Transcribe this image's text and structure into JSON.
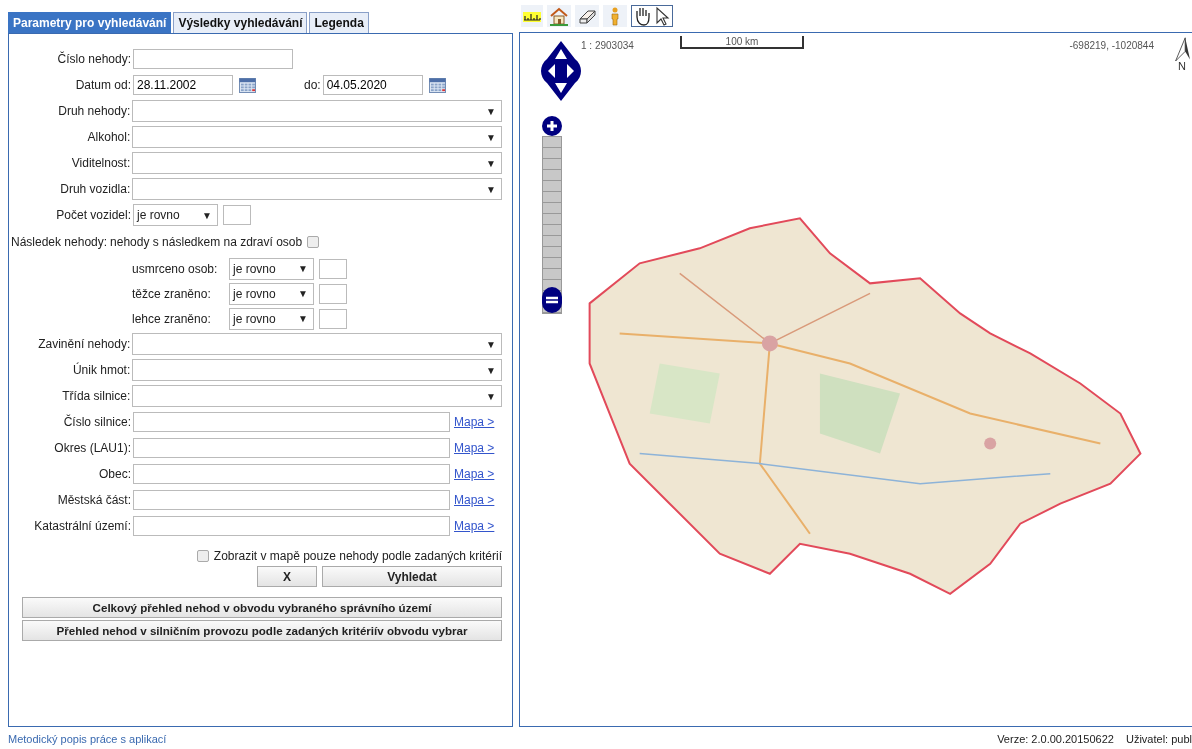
{
  "tabs": [
    {
      "label": "Parametry pro vyhledávání",
      "selected": true
    },
    {
      "label": "Výsledky vyhledávání",
      "selected": false
    },
    {
      "label": "Legenda",
      "selected": false
    }
  ],
  "form": [
    {
      "kind": "text",
      "label": "Číslo nehody:"
    },
    {
      "kind": "date",
      "label": "Datum od:",
      "value": "28.11.2002",
      "to_label": "do:",
      "to_value": "04.05.2020"
    },
    {
      "kind": "select",
      "label": "Druh nehody:",
      "arrow": "▼"
    },
    {
      "kind": "select",
      "label": "Alkohol:",
      "arrow": "▼"
    },
    {
      "kind": "select",
      "label": "Viditelnost:",
      "arrow": "▼"
    },
    {
      "kind": "select",
      "label": "Druh vozidla:",
      "arrow": "▼"
    },
    {
      "kind": "count",
      "label": "Počet vozidel:",
      "operator": "je rovno",
      "arrow": "▼"
    },
    {
      "kind": "check",
      "label": "Následek nehody:",
      "text": "nehody s následkem na zdraví osob",
      "checked": false
    },
    {
      "kind": "subcount",
      "label": "usmrceno osob:",
      "operator": "je rovno",
      "arrow": "▼"
    },
    {
      "kind": "subcount",
      "label": "těžce zraněno:",
      "operator": "je rovno",
      "arrow": "▼"
    },
    {
      "kind": "subcount",
      "label": "lehce zraněno:",
      "operator": "je rovno",
      "arrow": "▼"
    },
    {
      "kind": "select",
      "label": "Zavinění nehody:",
      "arrow": "▼"
    },
    {
      "kind": "select",
      "label": "Únik hmot:",
      "arrow": "▼"
    },
    {
      "kind": "select",
      "label": "Třída silnice:",
      "arrow": "▼"
    },
    {
      "kind": "link",
      "label": "Číslo silnice:",
      "link": "Mapa >"
    },
    {
      "kind": "link",
      "label": "Okres (LAU1):",
      "link": "Mapa >"
    },
    {
      "kind": "link",
      "label": "Obec:",
      "link": "Mapa >"
    },
    {
      "kind": "link",
      "label": "Městská část:",
      "link": "Mapa >"
    },
    {
      "kind": "link",
      "label": "Katastrální území:",
      "link": "Mapa >"
    }
  ],
  "map_filter": {
    "label": "Zobrazit v mapě pouze nehody podle zadaných kritérií",
    "checked": false
  },
  "buttons": [
    {
      "label": "X"
    },
    {
      "label": "Vyhledat"
    }
  ],
  "report_buttons": [
    {
      "label": "Celkový přehled nehod v obvodu vybraného správního území"
    },
    {
      "label": "Přehled nehod v silničním provozu podle zadaných kritériív obvodu vybrar"
    }
  ],
  "map": {
    "toolbar": [
      {
        "kind": "measure",
        "selected": false
      },
      {
        "kind": "home",
        "selected": false
      },
      {
        "kind": "eraser",
        "selected": false
      },
      {
        "kind": "person",
        "selected": false
      },
      {
        "kind": "pan",
        "selected": true
      }
    ],
    "zoom": {
      "level": 0
    },
    "scale": "1 : 2903034",
    "scalebar": "100 km",
    "coordinates": "-698219, -1020844",
    "north": "N"
  },
  "footer": {
    "link": "Metodický popis práce s aplikací",
    "version": "Verze: 2.0.00.20150622",
    "user": "Uživatel: publ"
  }
}
